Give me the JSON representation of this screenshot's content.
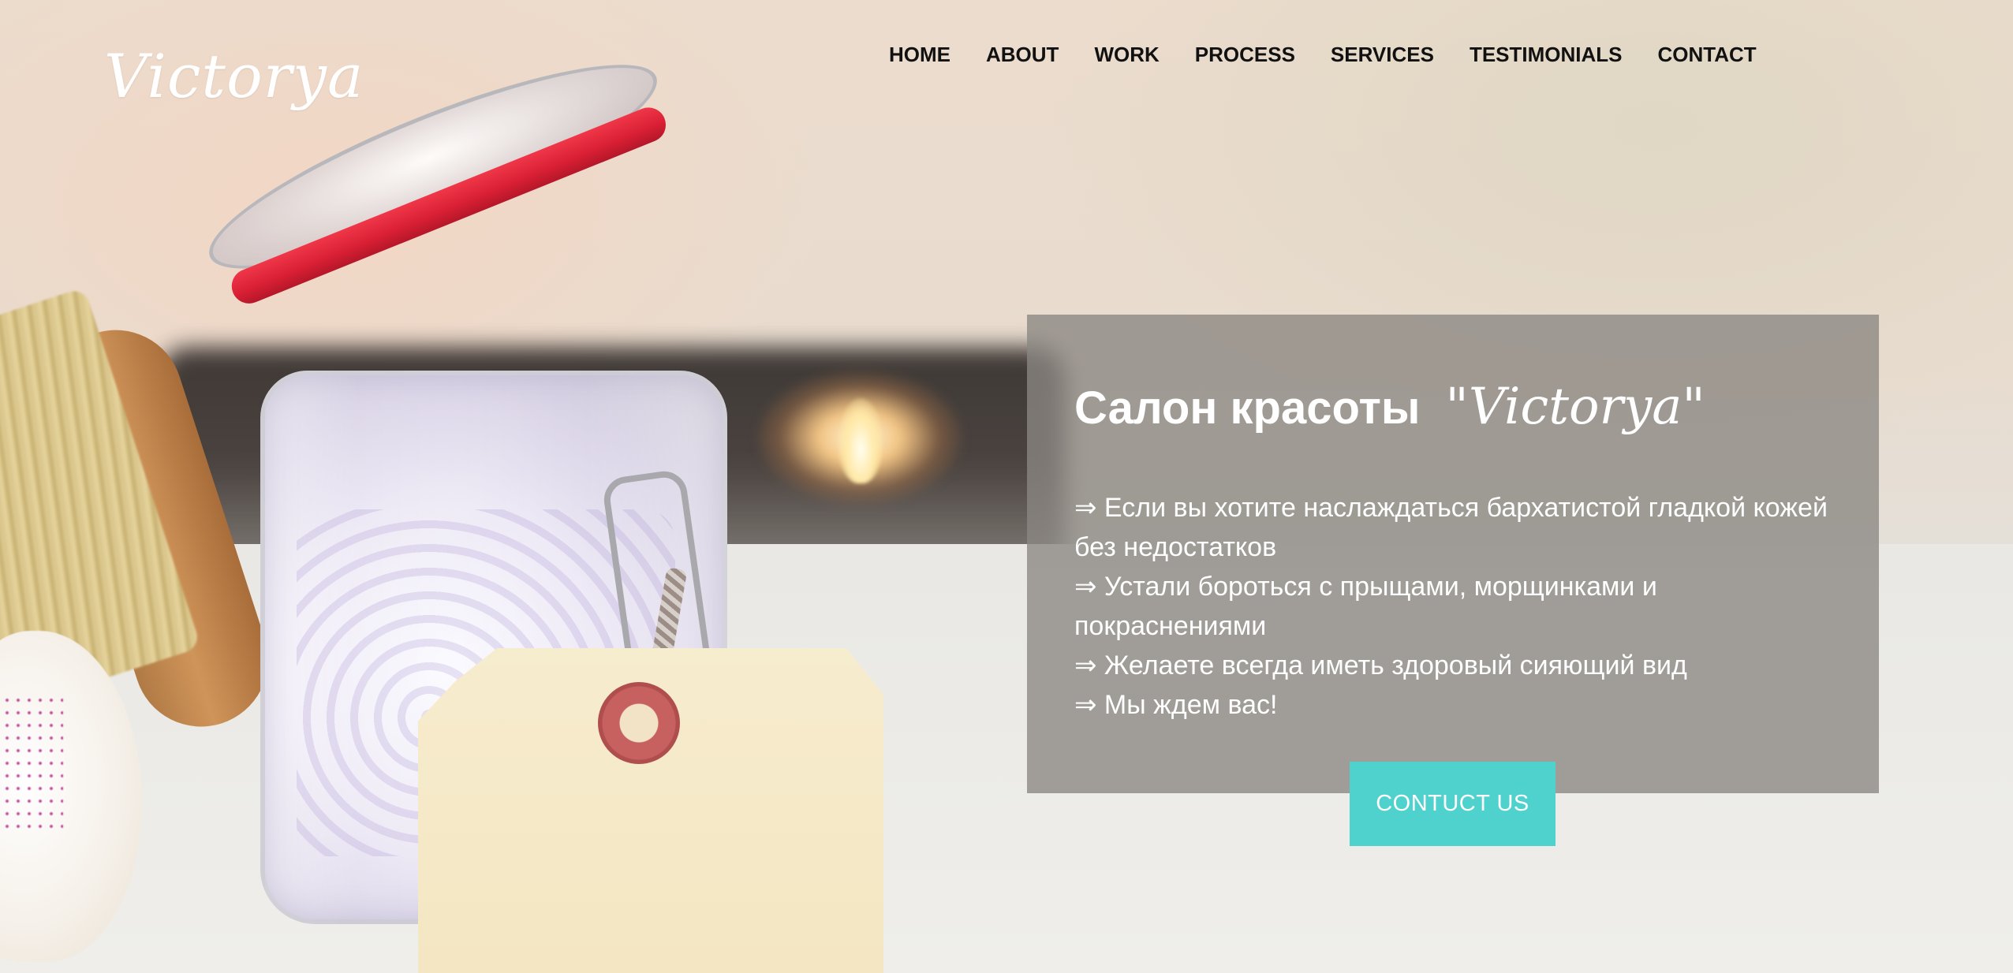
{
  "site": {
    "logo": "Victorya"
  },
  "nav": {
    "items": [
      {
        "label": "HOME"
      },
      {
        "label": "ABOUT"
      },
      {
        "label": "WORK"
      },
      {
        "label": "PROCESS"
      },
      {
        "label": "SERVICES"
      },
      {
        "label": "TESTIMONIALS"
      },
      {
        "label": "CONTACT"
      }
    ]
  },
  "hero": {
    "title": "Салон красоты",
    "title_brand": "\"Victorya\"",
    "bullets": [
      "⇒ Если вы хотите наслаждаться бархатистой гладкой кожей без недостатков",
      "⇒ Устали бороться с прыщами, морщинками и покраснениями",
      "⇒ Желаете всегда иметь здоровый сияющий вид",
      "⇒ Мы ждем вас!"
    ],
    "cta_label": "CONTUCT US"
  },
  "colors": {
    "accent": "#4fd2cd",
    "panel": "#8a8782",
    "text_light": "#ffffff",
    "nav_text": "#111111"
  },
  "icons": {
    "decor": [
      "jar-image",
      "candle-image",
      "brush-image",
      "orchid-image",
      "tag-image"
    ]
  }
}
